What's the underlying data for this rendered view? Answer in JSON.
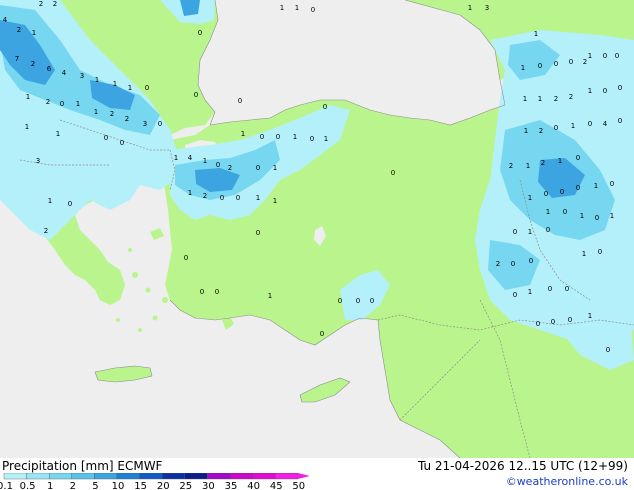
{
  "header": {
    "title": "Precipitation [mm]  ECMWF",
    "valid_time": "Tu 21-04-2026 12..15 UTC (12+99)",
    "copyright": "©weatheronline.co.uk"
  },
  "legend": {
    "levels": [
      "0.1",
      "0.5",
      "1",
      "2",
      "5",
      "10",
      "15",
      "20",
      "25",
      "30",
      "35",
      "40",
      "45",
      "50"
    ],
    "colors": [
      "#b4f0fa",
      "#96e6f5",
      "#78d7f0",
      "#5ac3ec",
      "#3ca5e1",
      "#1e82d2",
      "#145ac3",
      "#0a32a5",
      "#0a1e87",
      "#a00ac8",
      "#c80ac8",
      "#e10ad2",
      "#f01ee6"
    ]
  },
  "map": {
    "colors": {
      "land": "#b9f58c",
      "non_forecast_land": "#eeeeee",
      "sea": "#eeeeee",
      "precip_light": "#b4f0fa",
      "precip_mid": "#78d7f0",
      "precip_heavy": "#3ca5e1",
      "border": "#8c8c8c"
    },
    "value_labels": [
      "4",
      "2",
      "2",
      "2",
      "1",
      "7",
      "2",
      "6",
      "4",
      "3",
      "1",
      "1",
      "1",
      "0",
      "1",
      "2",
      "0",
      "1",
      "1",
      "2",
      "2",
      "3",
      "0",
      "1",
      "1",
      "0",
      "0",
      "3",
      "1",
      "4",
      "1",
      "0",
      "2",
      "0",
      "1",
      "1",
      "2",
      "0",
      "0",
      "1",
      "1",
      "1",
      "0",
      "2",
      "0",
      "0",
      "0",
      "0",
      "1",
      "0",
      "0",
      "0",
      "0",
      "0",
      "1",
      "0",
      "0",
      "1",
      "0",
      "1",
      "0",
      "0",
      "0",
      "0",
      "1",
      "1",
      "0",
      "1",
      "3",
      "1",
      "1",
      "0",
      "0",
      "1",
      "0",
      "0",
      "0",
      "2",
      "1",
      "1",
      "2",
      "2",
      "1",
      "0",
      "0",
      "1",
      "2",
      "0",
      "1",
      "0",
      "4",
      "0",
      "2",
      "1",
      "2",
      "1",
      "0",
      "1",
      "0",
      "0",
      "0",
      "1",
      "0",
      "1",
      "0",
      "1",
      "0",
      "1",
      "0",
      "1",
      "0",
      "2",
      "0",
      "0",
      "1",
      "0",
      "0",
      "1",
      "0",
      "0",
      "0",
      "0",
      "0",
      "1",
      "0"
    ]
  }
}
